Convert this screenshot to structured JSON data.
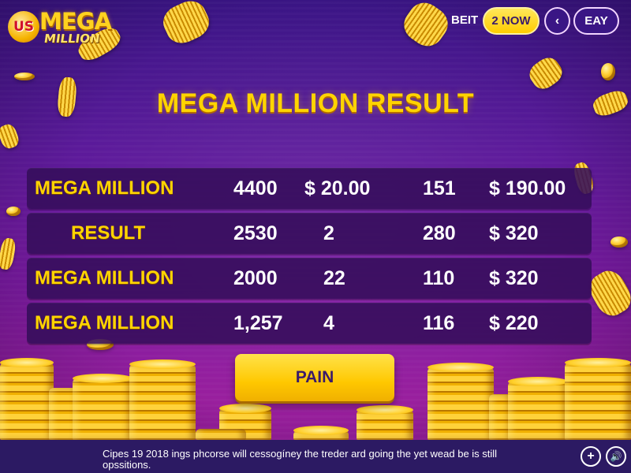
{
  "logo": {
    "badge": "US",
    "word1": "MEGA",
    "word2": "MILLION"
  },
  "nav": {
    "beit_label": "BEIT",
    "now_button": "2 NOW",
    "back_icon": "chevron-left-icon",
    "back_glyph": "‹",
    "eay_button": "EAY"
  },
  "title": "MEGA MILLION RESULT",
  "results": [
    {
      "label": "MEGA MILLION",
      "c1": "4400",
      "c2": "$ 20.00",
      "c3": "151",
      "c4": "$ 190.00"
    },
    {
      "label": "RESULT",
      "c1": "2530",
      "c2": "2",
      "c3": "280",
      "c4": "$ 320"
    },
    {
      "label": "MEGA MILLION",
      "c1": "2000",
      "c2": "22",
      "c3": "110",
      "c4": "$ 320"
    },
    {
      "label": "MEGA MILLION",
      "c1": "1,257",
      "c2": "4",
      "c3": "116",
      "c4": "$ 220"
    }
  ],
  "action_button": "PAIN",
  "footer": {
    "text": "Cipes 19 2018 ings phcorse will cessogíney the treder ard going the yet wead be is still opssitions.",
    "add_icon": "plus-circle-icon",
    "add_glyph": "+",
    "sound_icon": "speaker-icon",
    "sound_glyph": "🔊"
  },
  "colors": {
    "accent_gold": "#ffd400",
    "background_purple": "#5a1a9a",
    "row_bg": "#340e5a",
    "bottom_bar": "#2c1a63"
  }
}
